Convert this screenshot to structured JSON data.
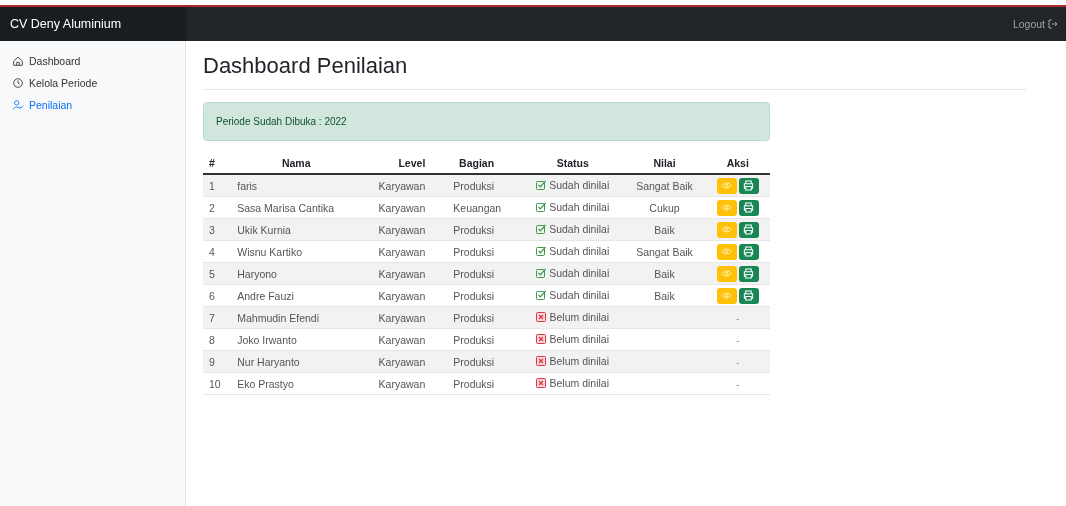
{
  "navbar": {
    "brand": "CV Deny Aluminium",
    "logout": "Logout"
  },
  "sidebar": {
    "items": [
      {
        "label": "Dashboard",
        "selected": false
      },
      {
        "label": "Kelola Periode",
        "selected": false
      },
      {
        "label": "Penilaian",
        "selected": true
      }
    ]
  },
  "page_title": "Dashboard Penilaian",
  "alert": "Periode Sudah Dibuka : 2022",
  "table": {
    "columns": [
      "#",
      "Nama",
      "Level",
      "Bagian",
      "Status",
      "Nilai",
      "Aksi"
    ],
    "rows": [
      {
        "no": "1",
        "nama": "faris",
        "level": "Karyawan",
        "bagian": "Produksi",
        "status": "Sudah dinilai",
        "kind": "done",
        "nilai": "Sangat Baik"
      },
      {
        "no": "2",
        "nama": "Sasa Marisa Cantika",
        "level": "Karyawan",
        "bagian": "Keuangan",
        "status": "Sudah dinilai",
        "kind": "done",
        "nilai": "Cukup"
      },
      {
        "no": "3",
        "nama": "Ukik Kurnia",
        "level": "Karyawan",
        "bagian": "Produksi",
        "status": "Sudah dinilai",
        "kind": "done",
        "nilai": "Baik"
      },
      {
        "no": "4",
        "nama": "Wisnu Kartiko",
        "level": "Karyawan",
        "bagian": "Produksi",
        "status": "Sudah dinilai",
        "kind": "done",
        "nilai": "Sangat Baik"
      },
      {
        "no": "5",
        "nama": "Haryono",
        "level": "Karyawan",
        "bagian": "Produksi",
        "status": "Sudah dinilai",
        "kind": "done",
        "nilai": "Baik"
      },
      {
        "no": "6",
        "nama": "Andre Fauzi",
        "level": "Karyawan",
        "bagian": "Produksi",
        "status": "Sudah dinilai",
        "kind": "done",
        "nilai": "Baik"
      },
      {
        "no": "7",
        "nama": "Mahmudin Efendi",
        "level": "Karyawan",
        "bagian": "Produksi",
        "status": "Belum dinilai",
        "kind": "pending",
        "aksi": "-"
      },
      {
        "no": "8",
        "nama": "Joko Irwanto",
        "level": "Karyawan",
        "bagian": "Produksi",
        "status": "Belum dinilai",
        "kind": "pending",
        "aksi": "-"
      },
      {
        "no": "9",
        "nama": "Nur Haryanto",
        "level": "Karyawan",
        "bagian": "Produksi",
        "status": "Belum dinilai",
        "kind": "pending",
        "aksi": "-"
      },
      {
        "no": "10",
        "nama": "Eko Prastyo",
        "level": "Karyawan",
        "bagian": "Produksi",
        "status": "Belum dinilai",
        "kind": "pending",
        "aksi": "-"
      }
    ]
  }
}
